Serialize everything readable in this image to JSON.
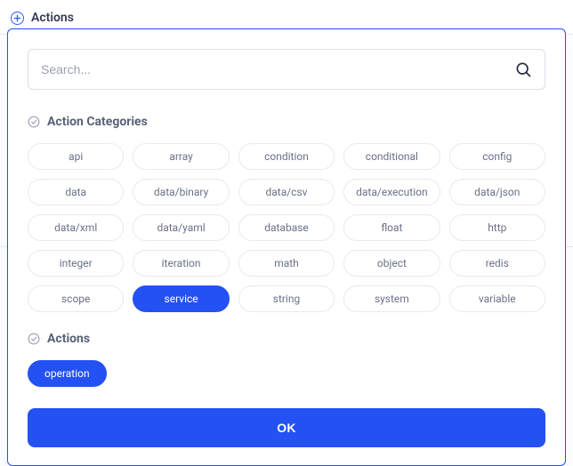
{
  "header": {
    "title": "Actions"
  },
  "search": {
    "placeholder": "Search..."
  },
  "sections": {
    "categories_title": "Action Categories",
    "actions_title": "Actions"
  },
  "categories": [
    {
      "label": "api",
      "selected": false
    },
    {
      "label": "array",
      "selected": false
    },
    {
      "label": "condition",
      "selected": false
    },
    {
      "label": "conditional",
      "selected": false
    },
    {
      "label": "config",
      "selected": false
    },
    {
      "label": "data",
      "selected": false
    },
    {
      "label": "data/binary",
      "selected": false
    },
    {
      "label": "data/csv",
      "selected": false
    },
    {
      "label": "data/execution",
      "selected": false
    },
    {
      "label": "data/json",
      "selected": false
    },
    {
      "label": "data/xml",
      "selected": false
    },
    {
      "label": "data/yaml",
      "selected": false
    },
    {
      "label": "database",
      "selected": false
    },
    {
      "label": "float",
      "selected": false
    },
    {
      "label": "http",
      "selected": false
    },
    {
      "label": "integer",
      "selected": false
    },
    {
      "label": "iteration",
      "selected": false
    },
    {
      "label": "math",
      "selected": false
    },
    {
      "label": "object",
      "selected": false
    },
    {
      "label": "redis",
      "selected": false
    },
    {
      "label": "scope",
      "selected": false
    },
    {
      "label": "service",
      "selected": true
    },
    {
      "label": "string",
      "selected": false
    },
    {
      "label": "system",
      "selected": false
    },
    {
      "label": "variable",
      "selected": false
    }
  ],
  "actions": [
    {
      "label": "operation",
      "selected": true
    }
  ],
  "buttons": {
    "ok": "OK"
  }
}
